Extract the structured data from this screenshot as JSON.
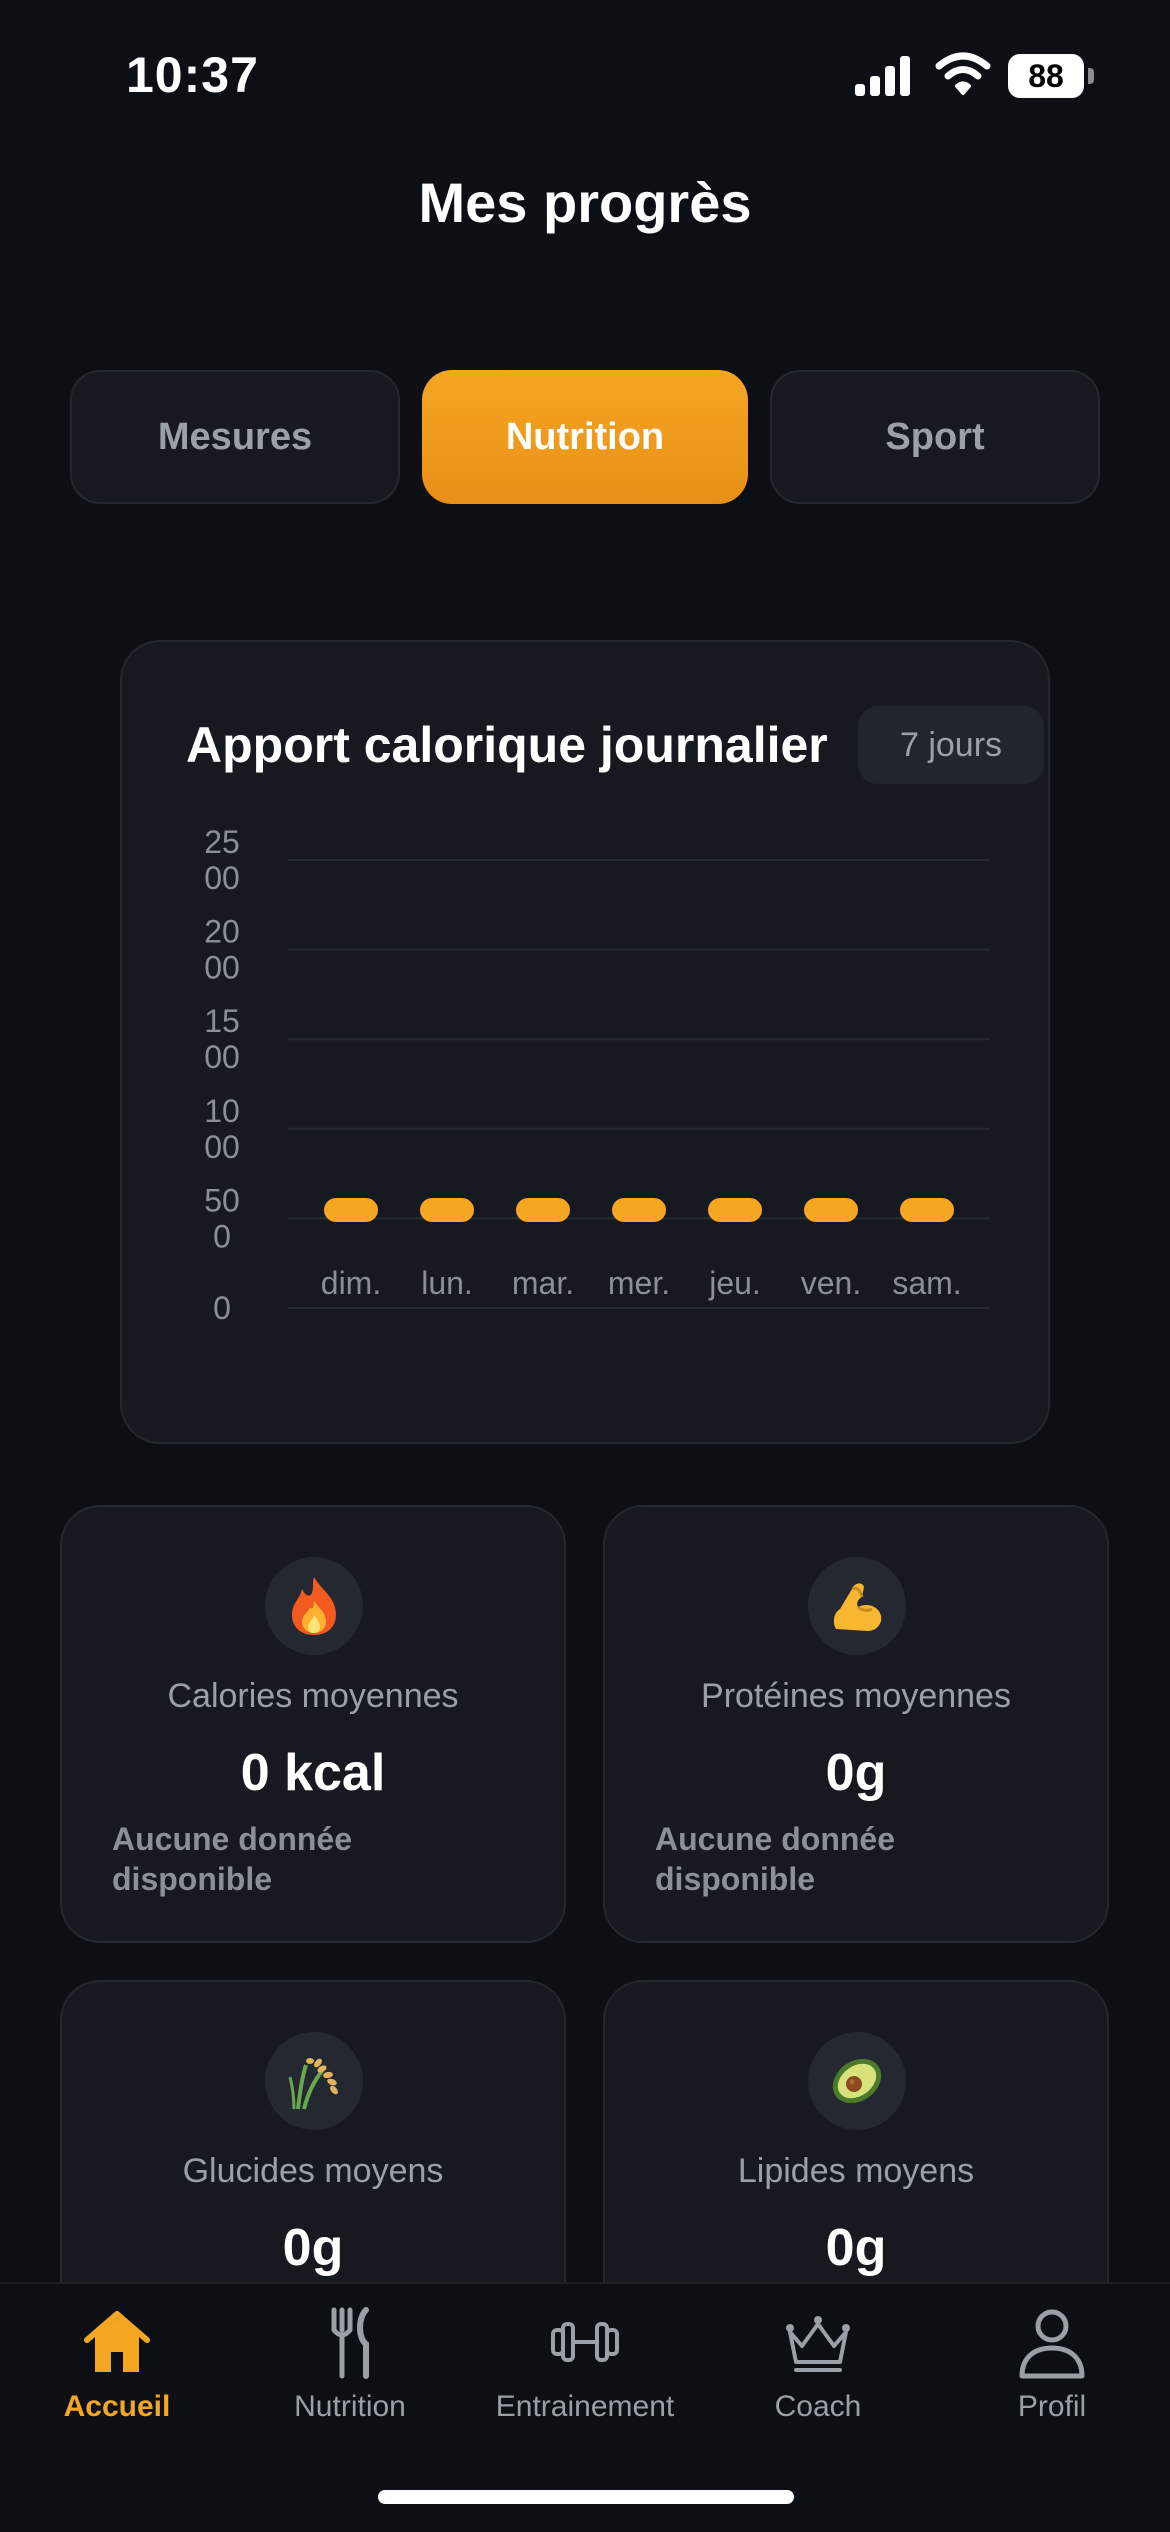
{
  "status_bar": {
    "time": "10:37",
    "battery": "88"
  },
  "page": {
    "title": "Mes progrès"
  },
  "tabs": [
    {
      "label": "Mesures",
      "active": false
    },
    {
      "label": "Nutrition",
      "active": true
    },
    {
      "label": "Sport",
      "active": false
    }
  ],
  "chart_card": {
    "title": "Apport calorique journalier",
    "period": "7 jours"
  },
  "chart_data": {
    "type": "bar",
    "title": "Apport calorique journalier",
    "categories": [
      "dim.",
      "lun.",
      "mar.",
      "mer.",
      "jeu.",
      "ven.",
      "sam."
    ],
    "values": [
      0,
      0,
      0,
      0,
      0,
      0,
      0
    ],
    "y_ticks": [
      [
        "0"
      ],
      [
        "50",
        "0"
      ],
      [
        "10",
        "00"
      ],
      [
        "15",
        "00"
      ],
      [
        "20",
        "00"
      ],
      [
        "25",
        "00"
      ]
    ],
    "ylim": [
      0,
      2500
    ],
    "grid": true,
    "bar_color": "#f5a623"
  },
  "stats": [
    {
      "icon": "fire-icon",
      "label": "Calories moyennes",
      "value": "0 kcal",
      "note_line1": "Aucune donnée",
      "note_line2": "disponible"
    },
    {
      "icon": "muscle-icon",
      "label": "Protéines moyennes",
      "value": "0g",
      "note_line1": "Aucune donnée",
      "note_line2": "disponible"
    },
    {
      "icon": "rice-icon",
      "label": "Glucides moyens",
      "value": "0g"
    },
    {
      "icon": "avocado-icon",
      "label": "Lipides moyens",
      "value": "0g"
    }
  ],
  "nav": [
    {
      "label": "Accueil",
      "icon": "home-icon",
      "active": true
    },
    {
      "label": "Nutrition",
      "icon": "fork-knife-icon",
      "active": false
    },
    {
      "label": "Entrainement",
      "icon": "dumbbell-icon",
      "active": false
    },
    {
      "label": "Coach",
      "icon": "crown-icon",
      "active": false
    },
    {
      "label": "Profil",
      "icon": "person-icon",
      "active": false
    }
  ],
  "colors": {
    "accent": "#f5a623",
    "background": "#0c0f14",
    "card": "#161a20",
    "muted": "#9aa0a8"
  }
}
